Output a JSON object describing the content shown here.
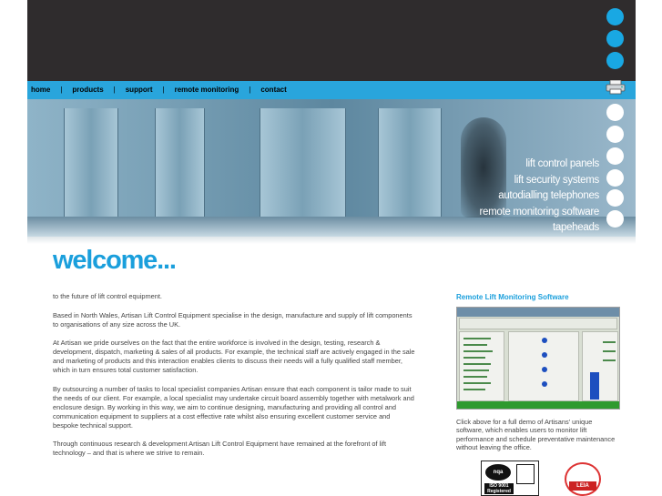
{
  "nav": {
    "items": [
      "home",
      "products",
      "support",
      "remote monitoring",
      "contact"
    ],
    "separator": "|"
  },
  "hero": {
    "services": [
      "lift control panels",
      "lift security systems",
      "autodialling telephones",
      "remote monitoring software",
      "tapeheads"
    ]
  },
  "main": {
    "heading": "welcome...",
    "paragraphs": [
      "to the future of lift control equipment.",
      "Based in North Wales, Artisan Lift Control Equipment specialise in the design, manufacture and supply of lift components to organisations of any size across the UK.",
      "At Artisan we pride ourselves on the fact that the entire workforce is involved in the design, testing, research & development, dispatch, marketing & sales of all products. For example, the technical staff are actively engaged in the sale and marketing of products and this interaction enables clients to discuss their needs will a fully qualified staff member, which in turn ensures total customer satisfaction.",
      "By outsourcing a number of tasks to local specialist companies Artisan ensure that each component is tailor made to suit the needs of our client. For example, a local specialist may undertake circuit board assembly together with metalwork and enclosure design. By working in this way, we aim to continue designing, manufacturing and providing all control and communication equipment to suppliers at a cost effective rate whilst also ensuring excellent customer service and bespoke technical support.",
      "Through continuous research & development Artisan Lift Control Equipment have remained at the forefront of lift technology – and that is where we strive to remain."
    ]
  },
  "sidebar": {
    "title": "Remote Lift Monitoring Software",
    "description": "Click above for a full demo of Artisans' unique software, which enables users to monitor lift performance and schedule preventative maintenance without leaving the office.",
    "iso_text": [
      "nqa",
      "ISO 9001",
      "Registered"
    ],
    "leia_text": "LEIA"
  },
  "colors": {
    "accent": "#1a9fdc",
    "navbar": "#29a5dc",
    "header": "#2f2c2d"
  },
  "icons": {
    "printer": "printer-icon"
  }
}
